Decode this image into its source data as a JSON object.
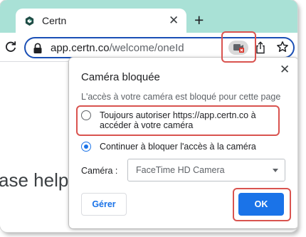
{
  "tab": {
    "title": "Certn",
    "close_glyph": "✕",
    "icon": "certn-logo-icon"
  },
  "new_tab_glyph": "+",
  "toolbar": {
    "url_domain": "app.certn.co",
    "url_path": "/welcome/oneId",
    "icons": [
      "reload-icon",
      "lock-icon",
      "camera-blocked-icon",
      "share-icon",
      "bookmark-star-icon"
    ]
  },
  "page": {
    "partial_text": "ase help"
  },
  "dialog": {
    "title": "Caméra bloquée",
    "close_glyph": "✕",
    "description": "L'accès à votre caméra est bloqué pour cette page",
    "options": [
      {
        "label_line1": "Toujours autoriser https://app.certn.co à",
        "label_line2": "accéder à votre caméra",
        "checked": false
      },
      {
        "label_line1": "Continuer à bloquer l'accès à la caméra",
        "checked": true
      }
    ],
    "camera_label": "Caméra :",
    "camera_value": "FaceTime HD Camera",
    "manage_label": "Gérer",
    "ok_label": "OK"
  },
  "colors": {
    "tabstrip": "#a9e1d6",
    "accent": "#1a73e8",
    "highlight": "#d9534f",
    "omnibox_border": "#1a4fb5"
  }
}
